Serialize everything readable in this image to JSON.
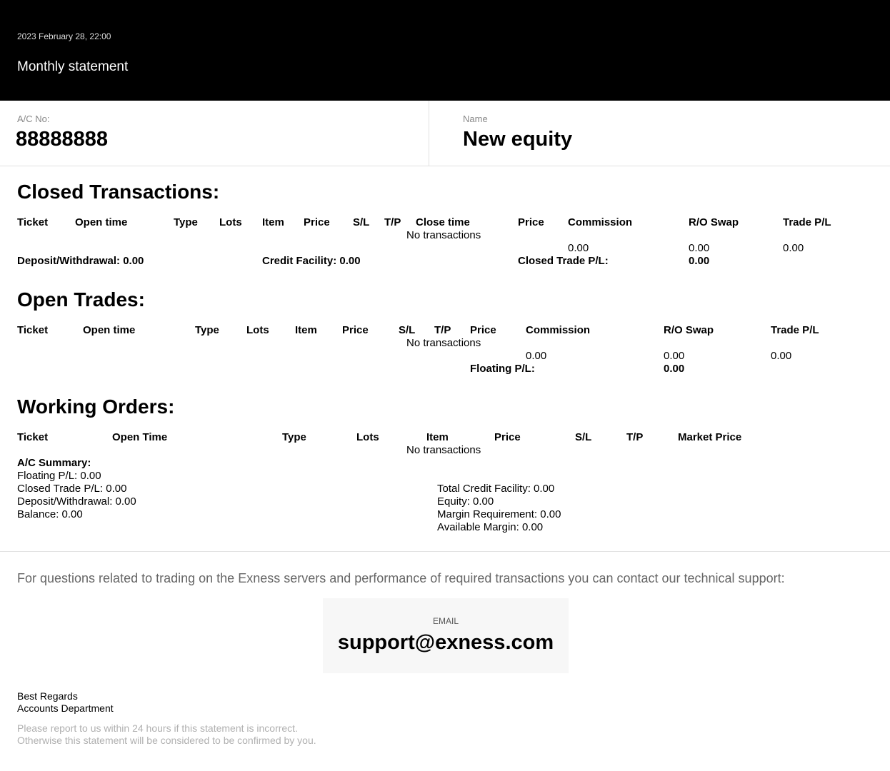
{
  "header": {
    "date": "2023 February 28, 22:00",
    "title": "Monthly statement"
  },
  "account": {
    "ac_label": "A/C No:",
    "ac_value": "88888888",
    "name_label": "Name",
    "name_value": "New equity"
  },
  "closed": {
    "title": "Closed Transactions:",
    "headers": [
      "Ticket",
      "Open time",
      "Type",
      "Lots",
      "Item",
      "Price",
      "S/L",
      "T/P",
      "Close time",
      "Price",
      "Commission",
      "R/O Swap",
      "Trade P/L"
    ],
    "empty": "No transactions",
    "commission_total": "0.00",
    "swap_total": "0.00",
    "pl_total": "0.00",
    "deposit": "Deposit/Withdrawal: 0.00",
    "credit": "Credit Facility: 0.00",
    "closed_pl_label": "Closed Trade P/L:",
    "closed_pl_value": "0.00"
  },
  "open": {
    "title": "Open Trades:",
    "headers": [
      "Ticket",
      "Open time",
      "Type",
      "Lots",
      "Item",
      "Price",
      "S/L",
      "T/P",
      "Price",
      "Commission",
      "R/O Swap",
      "Trade P/L"
    ],
    "empty": "No transactions",
    "commission_total": "0.00",
    "swap_total": "0.00",
    "pl_total": "0.00",
    "floating_label": "Floating P/L:",
    "floating_value": "0.00"
  },
  "working": {
    "title": "Working Orders:",
    "headers": [
      "Ticket",
      "Open Time",
      "Type",
      "Lots",
      "Item",
      "Price",
      "S/L",
      "T/P",
      "Market Price"
    ],
    "empty": "No transactions"
  },
  "summary": {
    "title": "A/C Summary:",
    "left": [
      "Floating P/L: 0.00",
      "Closed Trade P/L: 0.00",
      "Deposit/Withdrawal: 0.00",
      "Balance: 0.00"
    ],
    "right": [
      "Total Credit Facility: 0.00",
      "Equity: 0.00",
      "Margin Requirement: 0.00",
      "Available Margin: 0.00"
    ]
  },
  "support": {
    "text": "For questions related to trading on the Exness servers and performance of required transactions you can contact our technical support:",
    "email_label": "EMAIL",
    "email": "support@exness.com"
  },
  "footer": {
    "regards": "Best Regards",
    "dept": "Accounts Department",
    "note1": "Please report to us within 24 hours if this statement is incorrect.",
    "note2": "Otherwise this statement will be considered to be confirmed by you."
  }
}
